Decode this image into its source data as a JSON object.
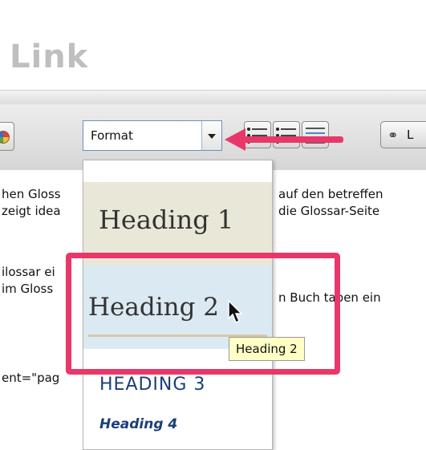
{
  "page": {
    "title": "Link"
  },
  "toolbar": {
    "format_value": "Format",
    "link_label": "L"
  },
  "editor": {
    "lines": [
      {
        "left": "hen Gloss",
        "right": "auf den betreffen"
      },
      {
        "left": "zeigt idea",
        "right": "die Glossar-Seite"
      },
      {
        "left": "ilossar ei",
        "right": ""
      },
      {
        "left": " im Gloss",
        "right": "n Buch taben ein"
      },
      {
        "left": "ent=\"pag",
        "right": ""
      }
    ]
  },
  "dropdown": {
    "items": [
      {
        "label": "Heading 1"
      },
      {
        "label": "Heading 2"
      },
      {
        "label": "HEADING 3"
      },
      {
        "label": "Heading 4"
      }
    ]
  },
  "tooltip": {
    "text": "Heading 2"
  },
  "colors": {
    "annotation": "#e8386a",
    "selected_item_bg": "#dbe9f2",
    "heading1_bg": "#e9e7d7",
    "heading_blue": "#1a3f78"
  },
  "icons": [
    "palette-icon",
    "numbered-list-icon",
    "bullet-list-icon",
    "indent-list-icon",
    "link-icon",
    "pointer-cursor-icon"
  ]
}
